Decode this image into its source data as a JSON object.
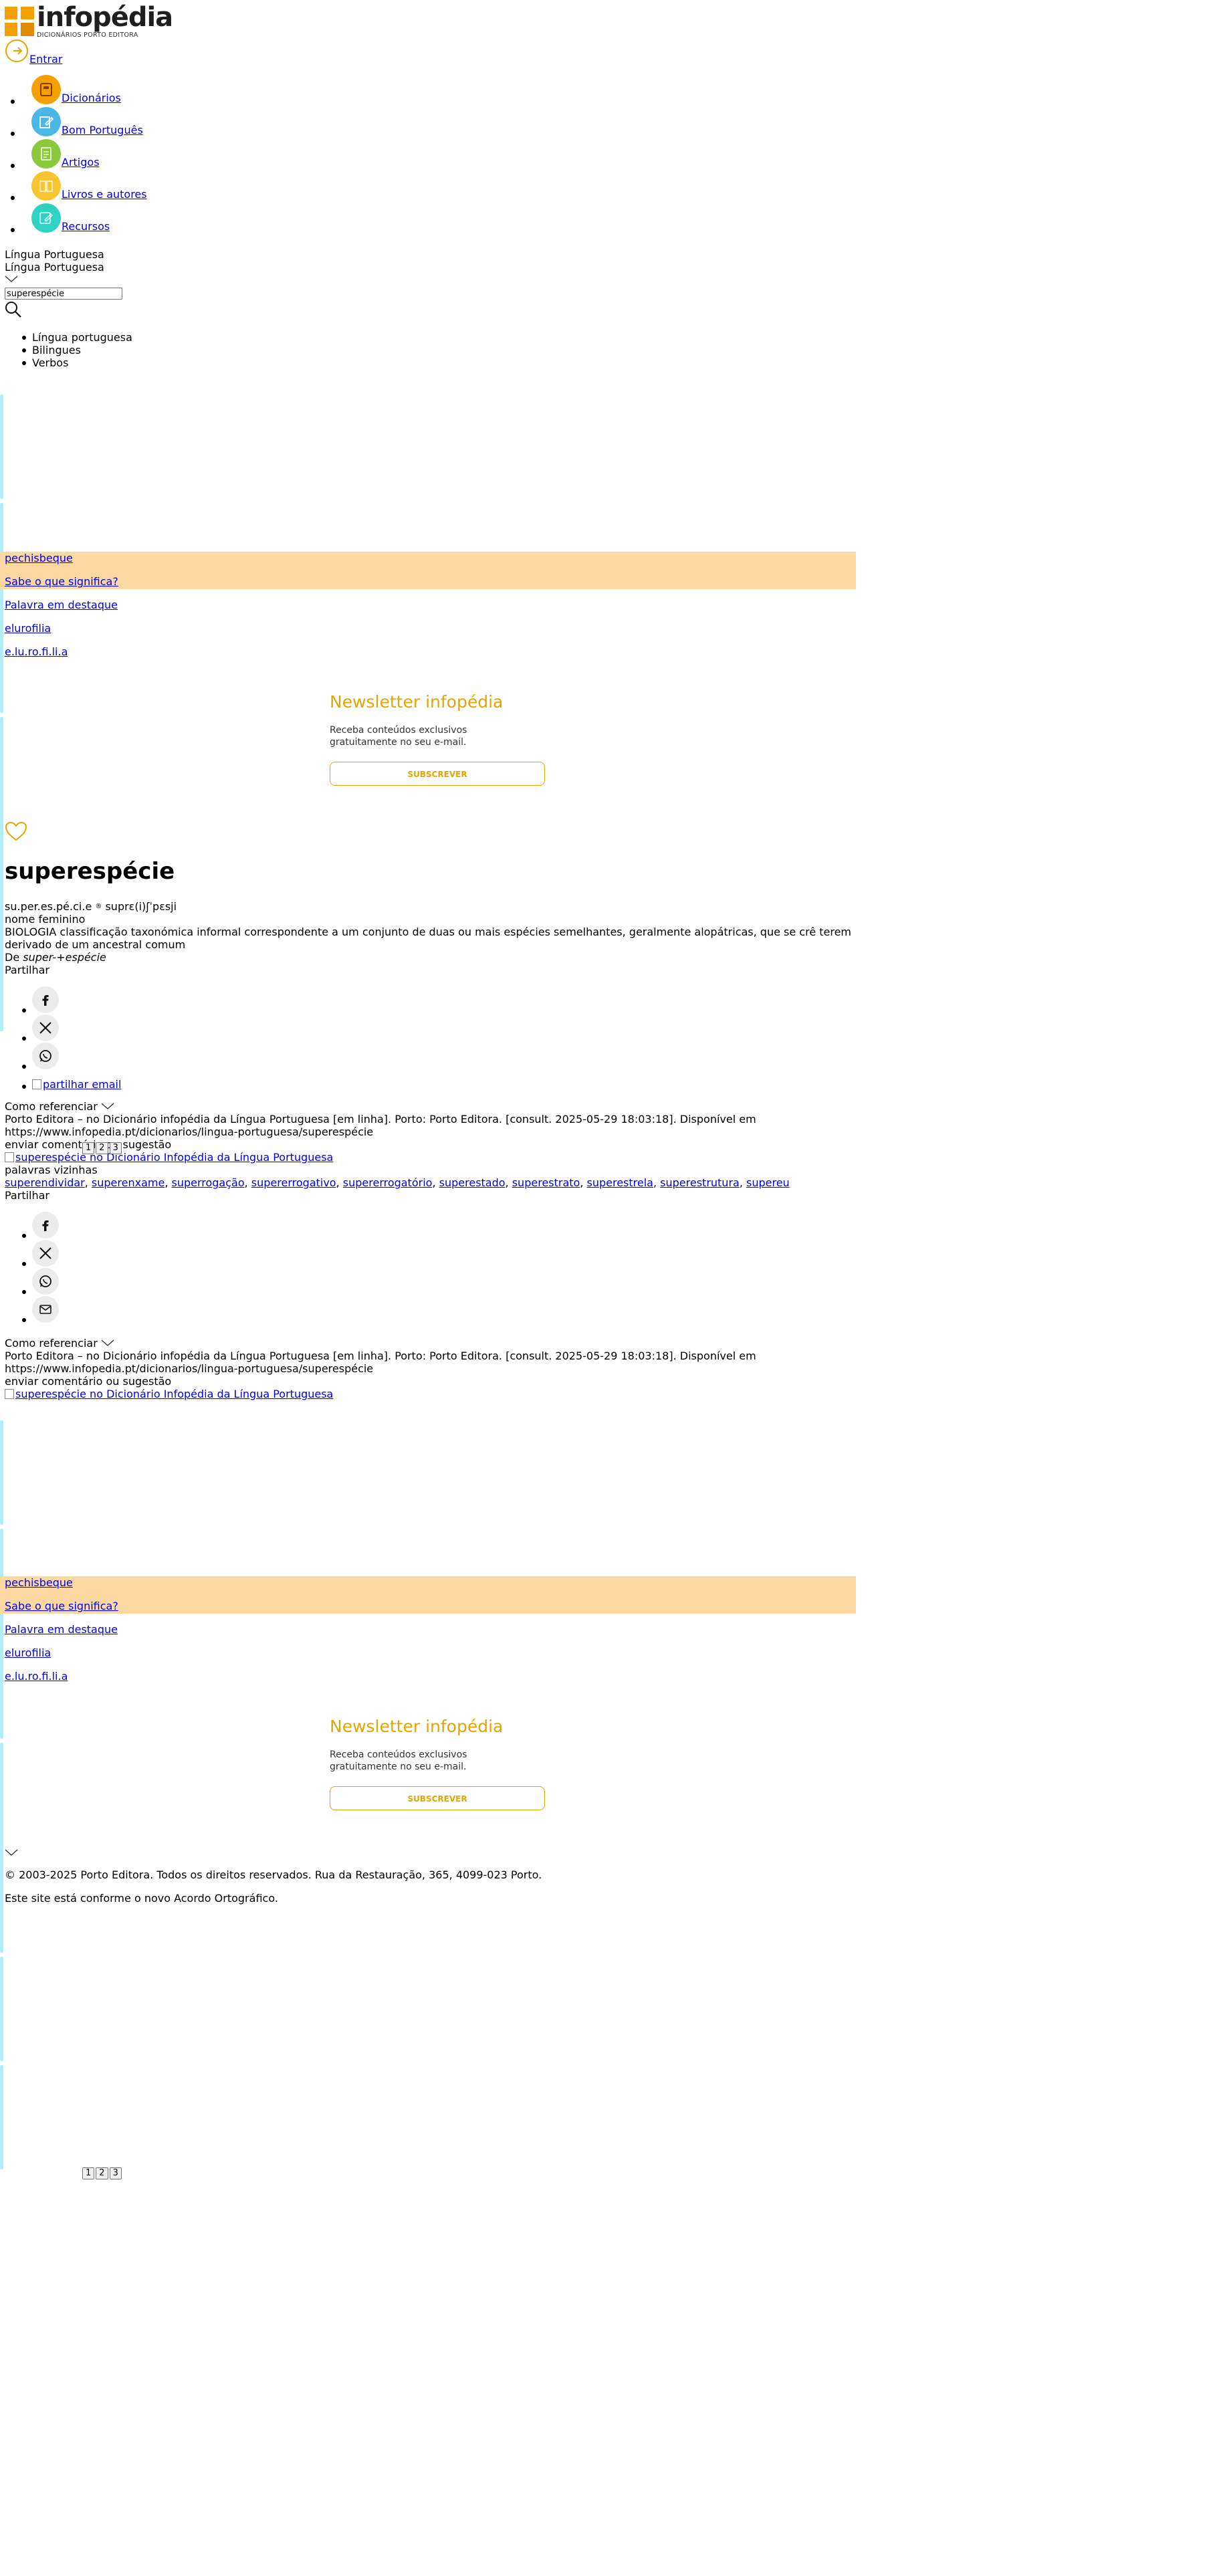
{
  "brand": {
    "name": "infopédia",
    "tagline": "DICIONÁRIOS PORTO EDITORA",
    "colors": {
      "accent": "#e3a500",
      "peach": "#fcd9a1",
      "cyan": "#b3ecfb"
    }
  },
  "header": {
    "login_label": "Entrar",
    "nav": [
      {
        "label": "Dicionários",
        "icon": "book-icon",
        "color": "#f5a000"
      },
      {
        "label": "Bom Português",
        "icon": "pencil-icon",
        "color": "#49b8e6"
      },
      {
        "label": "Artigos",
        "icon": "document-icon",
        "color": "#8cc83c"
      },
      {
        "label": "Livros e autores",
        "icon": "books-icon",
        "color": "#f7c531"
      },
      {
        "label": "Recursos",
        "icon": "edit-icon",
        "color": "#2fd1c0"
      }
    ]
  },
  "search": {
    "dictionary_label": "Língua Portuguesa",
    "dictionary_selected": "Língua Portuguesa",
    "value": "superespécie",
    "categories": [
      "Língua portuguesa",
      "Bilingues",
      "Verbos"
    ]
  },
  "sidebar": {
    "featured_word": "pechisbeque",
    "know_meaning": "Sabe o que significa?",
    "highlight_label": "Palavra em destaque",
    "highlight_word": "elurofilia",
    "highlight_syllables": "e.lu.ro.fi.li.a"
  },
  "newsletter": {
    "title": "Newsletter infopédia",
    "text": "Receba conteúdos exclusivos gratuitamente no seu e-mail.",
    "button": "SUBSCREVER"
  },
  "entry": {
    "word": "superespécie",
    "syllables": "su.per.es.pé.ci.e",
    "pronunciation": "suprɛ(i)ʃˈpɛsji",
    "grammar": "nome feminino",
    "domain": "BIOLOGIA",
    "definition": "classificação taxonómica informal correspondente a um conjunto de duas ou mais espécies semelhantes, geralmente alopátricas, que se crê terem derivado de um ancestral comum",
    "etymology_prefix": "De ",
    "etymology_term": "super-+espécie"
  },
  "share": {
    "label": "Partilhar",
    "email_label": "partilhar email"
  },
  "reference": {
    "label": "Como referenciar",
    "citation": "Porto Editora – no Dicionário infopédia da Língua Portuguesa [em linha]. Porto: Porto Editora. [consult. 2025-05-29 18:03:18]. Disponível em https://www.infopedia.pt/dicionarios/lingua-portuguesa/superespécie",
    "feedback": "enviar comentário ou sugestão",
    "image_alt": "superespécie no Dicionário Infopédia da Língua Portuguesa"
  },
  "neighbors": {
    "label": "palavras vizinhas",
    "words": [
      "superendividar",
      "superenxame",
      "superrogação",
      "supererrogativo",
      "supererrogatório",
      "superestado",
      "superestrato",
      "superestrela",
      "superestrutura",
      "supereu"
    ]
  },
  "pager": [
    "1",
    "2",
    "3"
  ],
  "footer": {
    "copyright": "© 2003-2025 Porto Editora. Todos os direitos reservados. Rua da Restauração, 365, 4099-023 Porto.",
    "agreement": "Este site está conforme o novo Acordo Ortográfico."
  }
}
